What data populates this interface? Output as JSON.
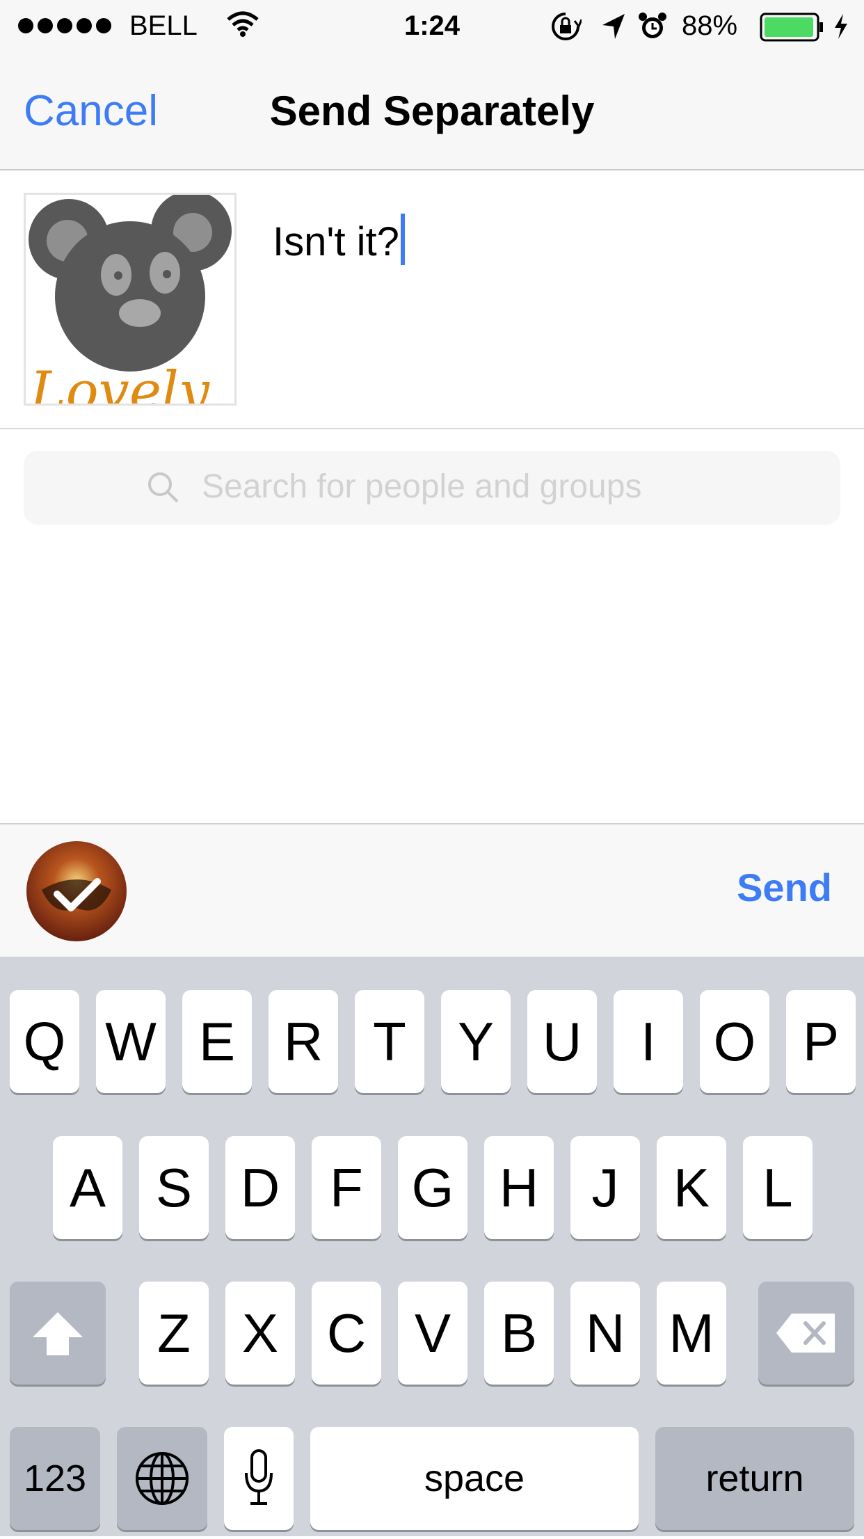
{
  "status_bar": {
    "carrier": "BELL",
    "time": "1:24",
    "battery_percent": "88%",
    "icons": [
      "signal-dots-icon",
      "wifi-icon",
      "rotation-lock-icon",
      "location-icon",
      "alarm-icon",
      "battery-icon",
      "charging-icon"
    ]
  },
  "nav": {
    "cancel_label": "Cancel",
    "title": "Send Separately"
  },
  "compose": {
    "message": "Isn't it?",
    "thumbnail_caption": "Lovely"
  },
  "search": {
    "placeholder": "Search for people and groups"
  },
  "selection": {
    "send_label": "Send"
  },
  "keyboard": {
    "row1": [
      "Q",
      "W",
      "E",
      "R",
      "T",
      "Y",
      "U",
      "I",
      "O",
      "P"
    ],
    "row2": [
      "A",
      "S",
      "D",
      "F",
      "G",
      "H",
      "J",
      "K",
      "L"
    ],
    "row3": [
      "Z",
      "X",
      "C",
      "V",
      "B",
      "N",
      "M"
    ],
    "numbers_label": "123",
    "space_label": "space",
    "return_label": "return"
  },
  "colors": {
    "accent": "#3d7cf5",
    "keyboard_bg": "#d1d4da",
    "battery_green": "#4cd964"
  }
}
